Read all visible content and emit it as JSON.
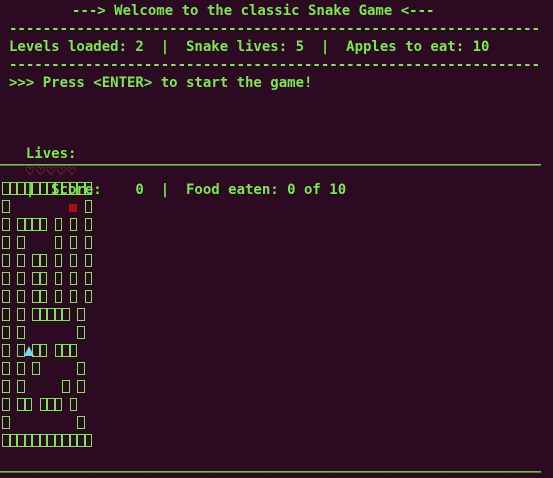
{
  "header": {
    "title": "---> Welcome to the classic Snake Game <---",
    "separator": "------------------------------------------------------------------------------------------------",
    "info": "Levels loaded: 2  |  Snake lives: 5  |  Apples to eat: 10",
    "prompt": ">>> Press <ENTER> to start the game!"
  },
  "status": {
    "lives_label": "Lives:",
    "hearts": "♡♡♡♡♡",
    "score_label": "|  Score:    0  |  Food eaten: 0 of 10"
  },
  "board": {
    "divider": "______________________________________________________________________________________________________",
    "grid": [
      "############",
      "#        A #",
      "# #### # # #",
      "# #    # # #",
      "# # ## # # #",
      "# # ## # # #",
      "# # ## # # #",
      "# # ##### # ",
      "# #       # ",
      "# #H## ### ",
      "# # #     #",
      "# #     # #",
      "# ## ### # ",
      "#         #",
      "############"
    ],
    "colors": {
      "wall": "#7be84f",
      "apple": "#a3100f",
      "snake_head": "#7ad4f2",
      "background": "#2c0a21"
    }
  }
}
